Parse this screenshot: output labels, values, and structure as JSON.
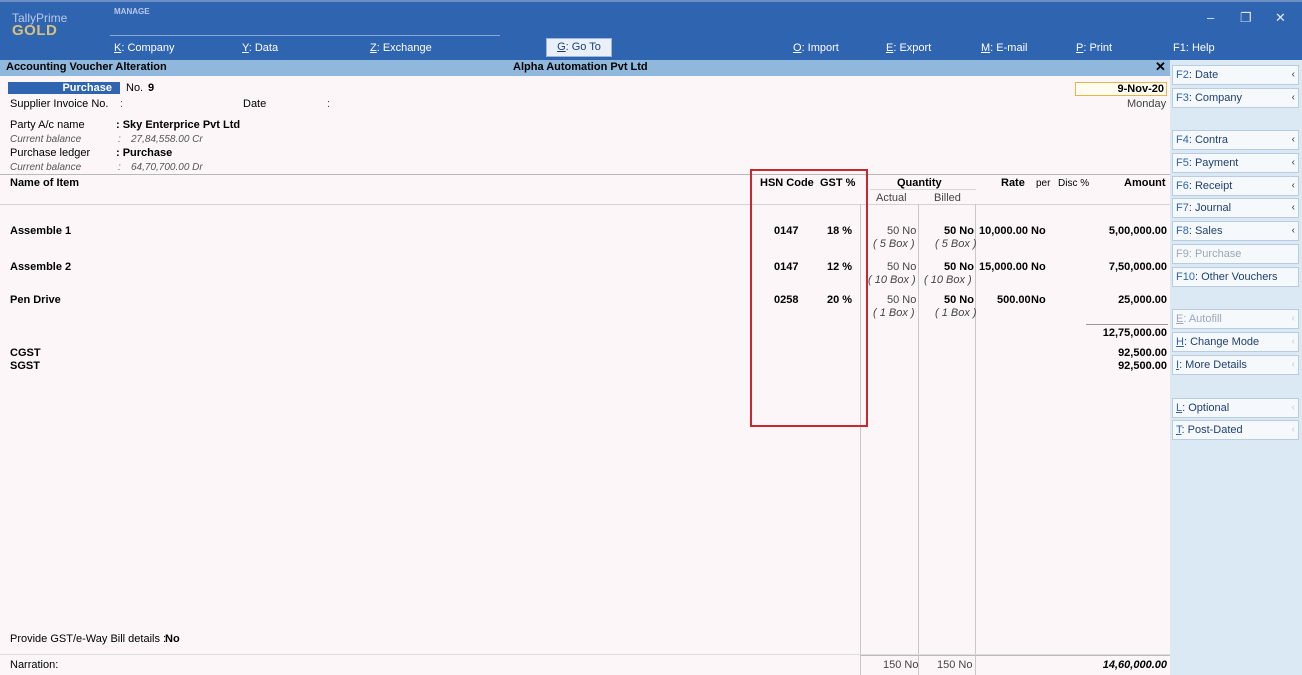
{
  "app": {
    "brand_top": "TallyPrime",
    "brand_bottom": "GOLD",
    "group_label": "MANAGE",
    "menu": [
      {
        "key": "K",
        "label": ": Company"
      },
      {
        "key": "Y",
        "label": ": Data"
      },
      {
        "key": "Z",
        "label": ": Exchange"
      },
      {
        "key": "G",
        "label": ": Go To"
      },
      {
        "key": "O",
        "label": ": Import"
      },
      {
        "key": "E",
        "label": ": Export"
      },
      {
        "key": "M",
        "label": ": E-mail"
      },
      {
        "key": "P",
        "label": ": Print"
      },
      {
        "key": "",
        "label": "F1: Help"
      }
    ],
    "window_controls": [
      "–",
      "❐",
      "✕"
    ]
  },
  "titlebar": {
    "screen": "Accounting Voucher Alteration",
    "company": "Alpha Automation Pvt Ltd",
    "close": "✕"
  },
  "voucher": {
    "type": "Purchase",
    "no_label": "No.",
    "no": "9",
    "date": "9-Nov-20",
    "day": "Monday",
    "supplier_invoice_label": "Supplier Invoice No.",
    "colon": ":",
    "date_label": "Date",
    "party_label": "Party A/c name",
    "party_value": ": Sky Enterprice Pvt Ltd",
    "current_balance_label": "Current balance",
    "party_balance": "27,84,558.00 Cr",
    "purchase_ledger_label": "Purchase ledger",
    "purchase_ledger_value": ": Purchase",
    "ledger_balance": "64,70,700.00 Dr"
  },
  "table": {
    "headers": {
      "name": "Name of Item",
      "hsn": "HSN Code",
      "gst": "GST %",
      "quantity": "Quantity",
      "actual": "Actual",
      "billed": "Billed",
      "rate": "Rate",
      "per": "per",
      "disc": "Disc %",
      "amount": "Amount"
    },
    "rows": [
      {
        "name": "Assemble 1",
        "hsn": "0147",
        "gst": "18 %",
        "actual": "50 No",
        "actual_alt": "( 5 Box )",
        "billed": "50 No",
        "billed_alt": "( 5 Box )",
        "rate": "10,000.00",
        "per": "No",
        "amount": "5,00,000.00"
      },
      {
        "name": "Assemble 2",
        "hsn": "0147",
        "gst": "12 %",
        "actual": "50 No",
        "actual_alt": "( 10 Box )",
        "billed": "50 No",
        "billed_alt": "( 10 Box )",
        "rate": "15,000.00",
        "per": "No",
        "amount": "7,50,000.00"
      },
      {
        "name": "Pen Drive",
        "hsn": "0258",
        "gst": "20 %",
        "actual": "50 No",
        "actual_alt": "( 1 Box )",
        "billed": "50 No",
        "billed_alt": "( 1 Box )",
        "rate": "500.00",
        "per": "No",
        "amount": "25,000.00"
      }
    ],
    "subtotal": "12,75,000.00",
    "taxes": [
      {
        "name": "CGST",
        "amount": "92,500.00"
      },
      {
        "name": "SGST",
        "amount": "92,500.00"
      }
    ]
  },
  "footer": {
    "gst_label": "Provide GST/e-Way Bill details :",
    "gst_value": "No",
    "narration_label": "Narration:",
    "total_actual": "150 No",
    "total_billed": "150 No",
    "total_amount": "14,60,000.00"
  },
  "sidebar": {
    "buttons": [
      {
        "key": "F2",
        "label": ": Date",
        "disabled": false
      },
      {
        "key": "F3",
        "label": ": Company",
        "disabled": false
      },
      {
        "key": "F4",
        "label": ": Contra",
        "disabled": false
      },
      {
        "key": "F5",
        "label": ": Payment",
        "disabled": false
      },
      {
        "key": "F6",
        "label": ": Receipt",
        "disabled": false
      },
      {
        "key": "F7",
        "label": ": Journal",
        "disabled": false
      },
      {
        "key": "F8",
        "label": ": Sales",
        "disabled": false
      },
      {
        "key": "F9",
        "label": ": Purchase",
        "disabled": true
      },
      {
        "key": "F10",
        "label": ": Other Vouchers",
        "disabled": false
      },
      {
        "key": "E",
        "label": ": Autofill",
        "disabled": true
      },
      {
        "key": "H",
        "label": ": Change Mode",
        "disabled": false
      },
      {
        "key": "I",
        "label": ": More Details",
        "disabled": false
      },
      {
        "key": "L",
        "label": ": Optional",
        "disabled": false
      },
      {
        "key": "T",
        "label": ": Post-Dated",
        "disabled": false
      }
    ],
    "arrow": "‹"
  },
  "colors": {
    "topbar": "#2e64b0",
    "titlebar": "#8fb8dc",
    "main_bg": "#fdf6f9",
    "sidebar_bg": "#dbe9f5",
    "highlight_border": "#c9282e"
  }
}
